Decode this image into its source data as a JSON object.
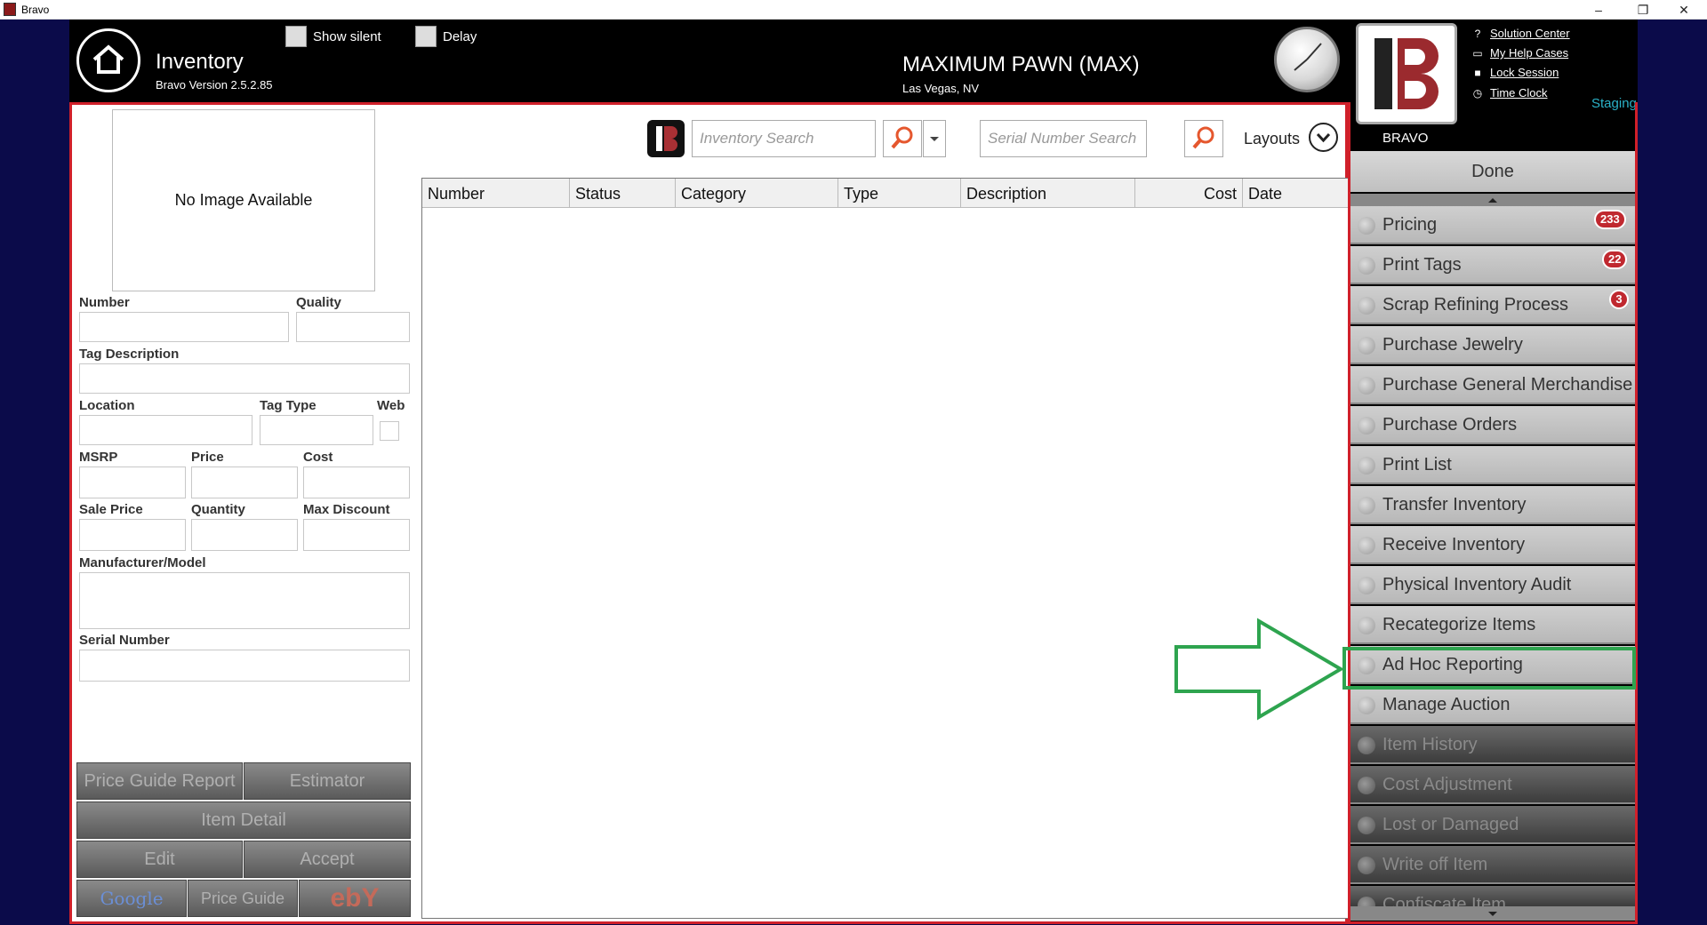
{
  "window": {
    "title": "Bravo",
    "minimize": "–",
    "restore": "❐",
    "close": "✕"
  },
  "header": {
    "module_title": "Inventory",
    "version": "Bravo Version 2.5.2.85",
    "show_silent_label": "Show silent",
    "delay_label": "Delay",
    "store_name": "MAXIMUM PAWN (MAX)",
    "store_location": "Las Vegas, NV",
    "brand_label": "BRAVO",
    "staging_label": "Staging",
    "links": [
      "Solution Center",
      "My Help Cases",
      "Lock Session",
      "Time Clock"
    ]
  },
  "form": {
    "no_image": "No Image Available",
    "labels": {
      "number": "Number",
      "quality": "Quality",
      "tag_description": "Tag Description",
      "location": "Location",
      "tag_type": "Tag Type",
      "web": "Web",
      "msrp": "MSRP",
      "price": "Price",
      "cost": "Cost",
      "sale_price": "Sale Price",
      "quantity": "Quantity",
      "max_discount": "Max Discount",
      "manufacturer_model": "Manufacturer/Model",
      "serial_number": "Serial Number"
    },
    "buttons": {
      "price_guide_report": "Price Guide Report",
      "estimator": "Estimator",
      "item_detail": "Item Detail",
      "edit": "Edit",
      "accept": "Accept",
      "google": "Google",
      "price_guide": "Price Guide",
      "ebay": "ebY"
    }
  },
  "search": {
    "inventory_placeholder": "Inventory Search",
    "serial_placeholder": "Serial Number Search",
    "layouts_label": "Layouts"
  },
  "grid": {
    "columns": [
      "Number",
      "Status",
      "Category",
      "Type",
      "Description",
      "Cost",
      "Date"
    ]
  },
  "menu": {
    "done_label": "Done",
    "items": [
      {
        "label": "Pricing",
        "badge": "233",
        "enabled": true
      },
      {
        "label": "Print Tags",
        "badge": "22",
        "enabled": true
      },
      {
        "label": "Scrap Refining Process",
        "badge": "3",
        "enabled": true
      },
      {
        "label": "Purchase Jewelry",
        "badge": "",
        "enabled": true
      },
      {
        "label": "Purchase General Merchandise",
        "badge": "",
        "enabled": true
      },
      {
        "label": "Purchase Orders",
        "badge": "",
        "enabled": true
      },
      {
        "label": "Print List",
        "badge": "",
        "enabled": true
      },
      {
        "label": "Transfer Inventory",
        "badge": "",
        "enabled": true
      },
      {
        "label": "Receive Inventory",
        "badge": "",
        "enabled": true
      },
      {
        "label": "Physical Inventory Audit",
        "badge": "",
        "enabled": true
      },
      {
        "label": "Recategorize Items",
        "badge": "",
        "enabled": true
      },
      {
        "label": "Ad Hoc Reporting",
        "badge": "",
        "enabled": true
      },
      {
        "label": "Manage Auction",
        "badge": "",
        "enabled": true
      },
      {
        "label": "Item History",
        "badge": "",
        "enabled": false
      },
      {
        "label": "Cost Adjustment",
        "badge": "",
        "enabled": false
      },
      {
        "label": "Lost or Damaged",
        "badge": "",
        "enabled": false
      },
      {
        "label": "Write off Item",
        "badge": "",
        "enabled": false
      },
      {
        "label": "Confiscate Item",
        "badge": "",
        "enabled": false
      }
    ]
  },
  "colors": {
    "accent_red": "#d0202a",
    "highlight_green": "#2ea44f",
    "staging_cyan": "#2bb3c9"
  }
}
